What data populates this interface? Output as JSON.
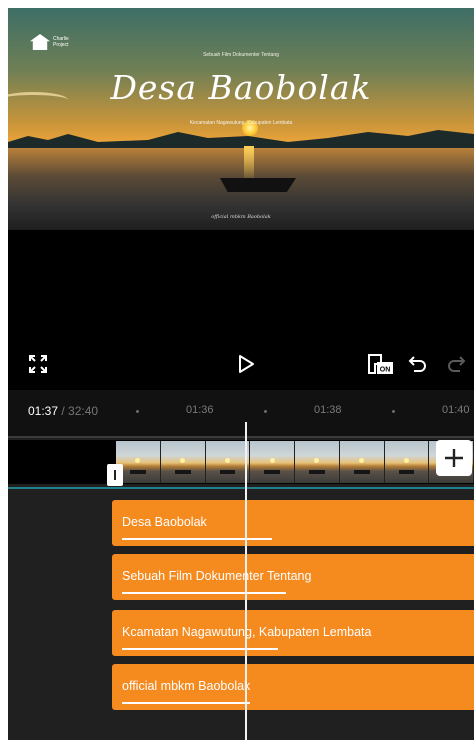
{
  "preview": {
    "brand": "Charlie Project",
    "subtitle_top": "Sebuah Film Dokumenter Tentang",
    "title": "Desa Baobolak",
    "subtitle_bottom": "Kecamatan Nagawutung, Kabupaten Lembata",
    "signature": "official mbkm Baobolak"
  },
  "controls": {
    "fullscreen_icon": "fullscreen-icon",
    "play_icon": "play-icon",
    "compare_label": "ON",
    "undo_icon": "undo-icon",
    "redo_icon": "redo-icon"
  },
  "timeline": {
    "current_time": "01:37",
    "total_time": " / 32:40",
    "ticks": [
      "01:36",
      "01:38",
      "01:40"
    ]
  },
  "text_clips": [
    {
      "label": "Desa Baobolak"
    },
    {
      "label": "Sebuah Film Dokumenter Tentang"
    },
    {
      "label": "Kcamatan Nagawutung, Kabupaten Lembata"
    },
    {
      "label": "official mbkm Baobolak"
    }
  ],
  "colors": {
    "clip_orange": "#f58a1f",
    "track_accent": "#1f7f8c",
    "playhead": "#f2f2f2"
  }
}
